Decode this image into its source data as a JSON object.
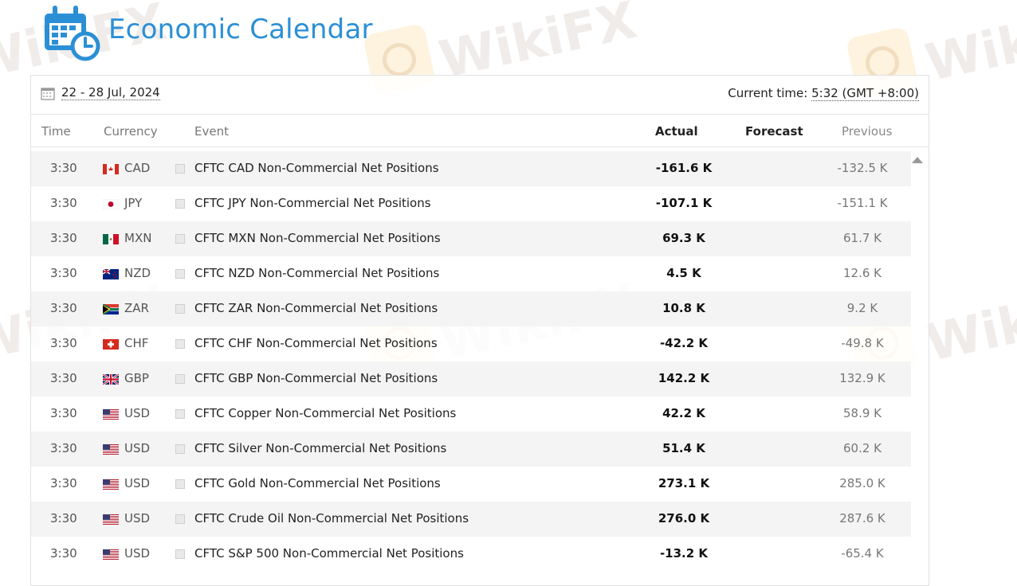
{
  "app": {
    "title": "Economic Calendar"
  },
  "watermark": {
    "text": "WikiFX"
  },
  "toolbar": {
    "date_range": "22 - 28 Jul, 2024",
    "current_time_label": "Current time:",
    "current_time_value": "5:32 (GMT +8:00)"
  },
  "columns": {
    "time": "Time",
    "currency": "Currency",
    "event": "Event",
    "actual": "Actual",
    "forecast": "Forecast",
    "previous": "Previous"
  },
  "rows": [
    {
      "time": "3:30",
      "flag": "flag-ca-icon",
      "currency": "CAD",
      "event": "CFTC CAD Non-Commercial Net Positions",
      "actual": "-161.6 K",
      "forecast": "",
      "previous": "-132.5 K"
    },
    {
      "time": "3:30",
      "flag": "flag-jp-icon",
      "currency": "JPY",
      "event": "CFTC JPY Non-Commercial Net Positions",
      "actual": "-107.1 K",
      "forecast": "",
      "previous": "-151.1 K"
    },
    {
      "time": "3:30",
      "flag": "flag-mx-icon",
      "currency": "MXN",
      "event": "CFTC MXN Non-Commercial Net Positions",
      "actual": "69.3 K",
      "forecast": "",
      "previous": "61.7 K"
    },
    {
      "time": "3:30",
      "flag": "flag-nz-icon",
      "currency": "NZD",
      "event": "CFTC NZD Non-Commercial Net Positions",
      "actual": "4.5 K",
      "forecast": "",
      "previous": "12.6 K"
    },
    {
      "time": "3:30",
      "flag": "flag-za-icon",
      "currency": "ZAR",
      "event": "CFTC ZAR Non-Commercial Net Positions",
      "actual": "10.8 K",
      "forecast": "",
      "previous": "9.2 K"
    },
    {
      "time": "3:30",
      "flag": "flag-ch-icon",
      "currency": "CHF",
      "event": "CFTC CHF Non-Commercial Net Positions",
      "actual": "-42.2 K",
      "forecast": "",
      "previous": "-49.8 K"
    },
    {
      "time": "3:30",
      "flag": "flag-gb-icon",
      "currency": "GBP",
      "event": "CFTC GBP Non-Commercial Net Positions",
      "actual": "142.2 K",
      "forecast": "",
      "previous": "132.9 K"
    },
    {
      "time": "3:30",
      "flag": "flag-us-icon",
      "currency": "USD",
      "event": "CFTC Copper Non-Commercial Net Positions",
      "actual": "42.2 K",
      "forecast": "",
      "previous": "58.9 K"
    },
    {
      "time": "3:30",
      "flag": "flag-us-icon",
      "currency": "USD",
      "event": "CFTC Silver Non-Commercial Net Positions",
      "actual": "51.4 K",
      "forecast": "",
      "previous": "60.2 K"
    },
    {
      "time": "3:30",
      "flag": "flag-us-icon",
      "currency": "USD",
      "event": "CFTC Gold Non-Commercial Net Positions",
      "actual": "273.1 K",
      "forecast": "",
      "previous": "285.0 K"
    },
    {
      "time": "3:30",
      "flag": "flag-us-icon",
      "currency": "USD",
      "event": "CFTC Crude Oil Non-Commercial Net Positions",
      "actual": "276.0 K",
      "forecast": "",
      "previous": "287.6 K"
    },
    {
      "time": "3:30",
      "flag": "flag-us-icon",
      "currency": "USD",
      "event": "CFTC S&P 500 Non-Commercial Net Positions",
      "actual": "-13.2 K",
      "forecast": "",
      "previous": "-65.4 K"
    }
  ],
  "colors": {
    "accent": "#2b8fd6",
    "row_alt": "#f4f4f4"
  }
}
